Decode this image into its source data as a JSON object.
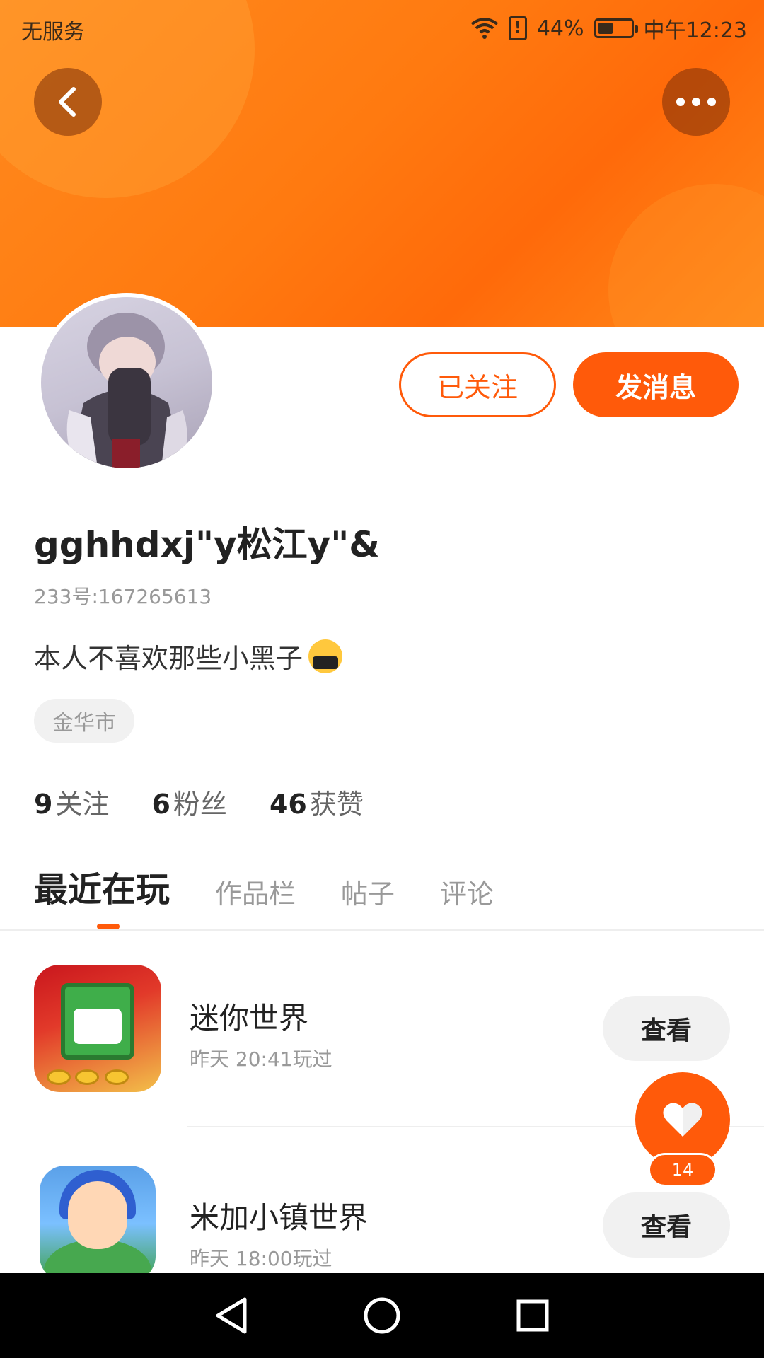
{
  "status_bar": {
    "carrier": "无服务",
    "battery": "44%",
    "time": "中午12:23",
    "sim_alert": "!"
  },
  "header": {
    "back_icon": "chevron-left-icon",
    "more_icon": "more-horizontal-icon"
  },
  "profile": {
    "username": "gghhdxj\"y松江y\"&",
    "user_id": "233号:167265613",
    "bio": "本人不喜欢那些小黑子",
    "bio_emoji": "face-with-symbols-on-mouth",
    "location": "金华市",
    "follow_button": "已关注",
    "message_button": "发消息",
    "accent_color": "#ff5a0a"
  },
  "stats": [
    {
      "value": "9",
      "label": "关注"
    },
    {
      "value": "6",
      "label": "粉丝"
    },
    {
      "value": "46",
      "label": "获赞"
    }
  ],
  "tabs": [
    {
      "label": "最近在玩",
      "active": true
    },
    {
      "label": "作品栏",
      "active": false
    },
    {
      "label": "帖子",
      "active": false
    },
    {
      "label": "评论",
      "active": false
    }
  ],
  "games": [
    {
      "name": "迷你世界",
      "time": "昨天 20:41玩过",
      "action": "查看"
    },
    {
      "name": "米加小镇世界",
      "time": "昨天 18:00玩过",
      "action": "查看"
    }
  ],
  "like": {
    "count": "14",
    "icon": "heart-icon"
  },
  "nav": {
    "back": "nav-back-icon",
    "home": "nav-home-icon",
    "recents": "nav-recents-icon"
  }
}
